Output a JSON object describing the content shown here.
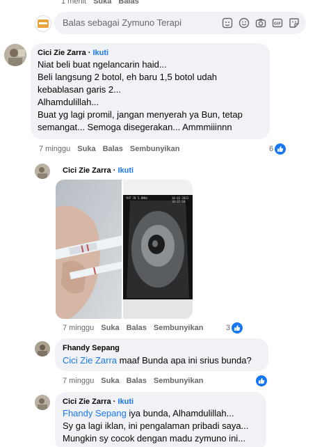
{
  "top_meta": {
    "time": "1 menit",
    "like": "Suka",
    "reply": "Balas"
  },
  "reply_box": {
    "placeholder": "Balas sebagai Zymuno Terapi"
  },
  "comment1": {
    "author": "Cici Zie Zarra",
    "follow": "Ikuti",
    "lines": [
      "Niat beli buat ngelancarin haid...",
      "Beli langsung 2 botol, eh baru 1,5 botol udah",
      "kebablasan garis 2...",
      "Alhamdulillah...",
      "Buat yg lagi promil, jangan menyerah ya Bun, tetap",
      "semangat... Semoga disegerakan... Ammmiiinnn"
    ],
    "time": "7 minggu",
    "like": "Suka",
    "reply": "Balas",
    "hide": "Sembunyikan",
    "reactions": "6"
  },
  "comment2": {
    "author": "Cici Zie Zarra",
    "follow": "Ikuti",
    "time": "7 minggu",
    "like": "Suka",
    "reply": "Balas",
    "hide": "Sembunyikan",
    "reactions": "3",
    "photo_ultrasound_text": [
      "YHT 70",
      "5.0MHz",
      "10-03-2023",
      "10:37:18"
    ]
  },
  "comment3": {
    "author": "Fhandy Sepang",
    "mention": "Cici Zie Zarra",
    "text": " maaf Bunda apa ini srius bunda?",
    "time": "7 minggu",
    "like": "Suka",
    "reply": "Balas",
    "hide": "Sembunyikan"
  },
  "comment4": {
    "author": "Cici Zie Zarra",
    "follow": "Ikuti",
    "mention": "Fhandy Sepang",
    "line1": " iya bunda, Alhamdulillah...",
    "line2": "Sy ga lagi iklan, ini pengalaman pribadi saya...",
    "line3": "Mungkin sy cocok dengan madu zymuno ini..."
  },
  "colors": {
    "accent": "#1877f2",
    "bubble": "#f0f2f5",
    "meta": "#65676b"
  }
}
